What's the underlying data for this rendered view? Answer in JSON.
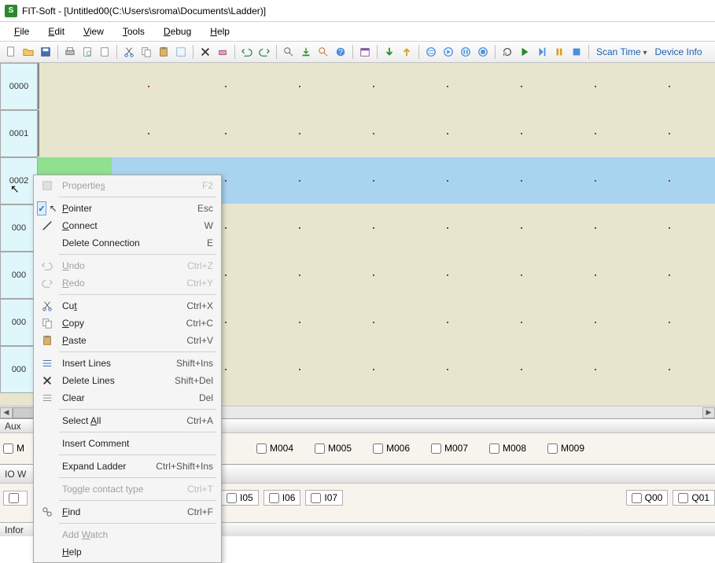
{
  "title": "FIT-Soft - [Untitled00(C:\\Users\\sroma\\Documents\\Ladder)]",
  "app_icon_letter": "S",
  "menubar": [
    "File",
    "Edit",
    "View",
    "Tools",
    "Debug",
    "Help"
  ],
  "toolbar_right": {
    "scan_time": "Scan Time",
    "device_info": "Device Info"
  },
  "rows": [
    "0000",
    "0001",
    "0002",
    "000",
    "000",
    "000",
    "000"
  ],
  "ticks_x": [
    140,
    238,
    332,
    426,
    520,
    614,
    708,
    802
  ],
  "aux": {
    "title": "Aux",
    "items": [
      "M",
      "M004",
      "M005",
      "M006",
      "M007",
      "M008",
      "M009"
    ]
  },
  "io": {
    "title": "IO W",
    "inputs_left": [
      ""
    ],
    "inputs_mid": [
      "I05",
      "I06",
      "I07"
    ],
    "outputs": [
      "Q00",
      "Q01"
    ]
  },
  "status": "Infor",
  "context_menu": [
    {
      "type": "item",
      "icon": "props",
      "label": "Propertie",
      "ul": "s",
      "shortcut": "F2",
      "disabled": true
    },
    {
      "type": "sep"
    },
    {
      "type": "item",
      "icon": "pointer-check",
      "label": "",
      "ul": "P",
      "after": "ointer",
      "shortcut": "Esc"
    },
    {
      "type": "item",
      "icon": "line",
      "label": "",
      "ul": "C",
      "after": "onnect",
      "shortcut": "W"
    },
    {
      "type": "item",
      "icon": "",
      "label": "Delete Connection",
      "shortcut": "E"
    },
    {
      "type": "sep"
    },
    {
      "type": "item",
      "icon": "undo",
      "label": "",
      "ul": "U",
      "after": "ndo",
      "shortcut": "Ctrl+Z",
      "disabled": true
    },
    {
      "type": "item",
      "icon": "redo",
      "label": "",
      "ul": "R",
      "after": "edo",
      "shortcut": "Ctrl+Y",
      "disabled": true
    },
    {
      "type": "sep"
    },
    {
      "type": "item",
      "icon": "cut",
      "label": "Cu",
      "ul": "t",
      "shortcut": "Ctrl+X"
    },
    {
      "type": "item",
      "icon": "copy",
      "label": "",
      "ul": "C",
      "after": "opy",
      "shortcut": "Ctrl+C"
    },
    {
      "type": "item",
      "icon": "paste",
      "label": "",
      "ul": "P",
      "after": "aste",
      "shortcut": "Ctrl+V"
    },
    {
      "type": "sep"
    },
    {
      "type": "item",
      "icon": "insert-lines",
      "label": "Insert Lines",
      "shortcut": "Shift+Ins"
    },
    {
      "type": "item",
      "icon": "delete-lines",
      "label": "Delete Lines",
      "shortcut": "Shift+Del"
    },
    {
      "type": "item",
      "icon": "clear",
      "label": "Clear",
      "shortcut": "Del"
    },
    {
      "type": "sep"
    },
    {
      "type": "item",
      "icon": "",
      "label": "Select ",
      "ul": "A",
      "after": "ll",
      "shortcut": "Ctrl+A"
    },
    {
      "type": "sep"
    },
    {
      "type": "item",
      "icon": "",
      "label": "Insert Comment",
      "shortcut": ""
    },
    {
      "type": "sep"
    },
    {
      "type": "item",
      "icon": "",
      "label": "Expand Ladder",
      "shortcut": "Ctrl+Shift+Ins"
    },
    {
      "type": "sep"
    },
    {
      "type": "item",
      "icon": "",
      "label": "Toggle contact type",
      "shortcut": "Ctrl+T",
      "disabled": true
    },
    {
      "type": "sep"
    },
    {
      "type": "item",
      "icon": "find",
      "label": "",
      "ul": "F",
      "after": "ind",
      "shortcut": "Ctrl+F"
    },
    {
      "type": "sep"
    },
    {
      "type": "item",
      "icon": "",
      "label": "Add ",
      "ul": "W",
      "after": "atch",
      "disabled": true
    },
    {
      "type": "item",
      "icon": "",
      "label": "",
      "ul": "H",
      "after": "elp"
    }
  ]
}
